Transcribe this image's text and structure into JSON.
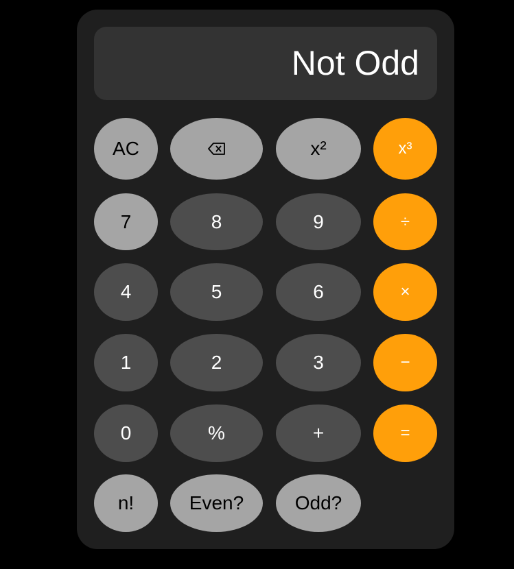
{
  "display": {
    "value": "Not Odd"
  },
  "buttons": {
    "ac": "AC",
    "backspace_icon": "backspace-icon",
    "square": "x²",
    "cube": "x³",
    "seven": "7",
    "eight": "8",
    "nine": "9",
    "divide": "÷",
    "four": "4",
    "five": "5",
    "six": "6",
    "multiply": "×",
    "one": "1",
    "two": "2",
    "three": "3",
    "minus": "−",
    "zero": "0",
    "percent": "%",
    "plus": "+",
    "equals": "=",
    "factorial": "n!",
    "even": "Even?",
    "odd": "Odd?"
  },
  "colors": {
    "background": "#000000",
    "body": "#1f1f1f",
    "display": "#333333",
    "light_button": "#a5a5a5",
    "dark_button": "#4d4d4d",
    "accent": "#ff9f0a"
  }
}
